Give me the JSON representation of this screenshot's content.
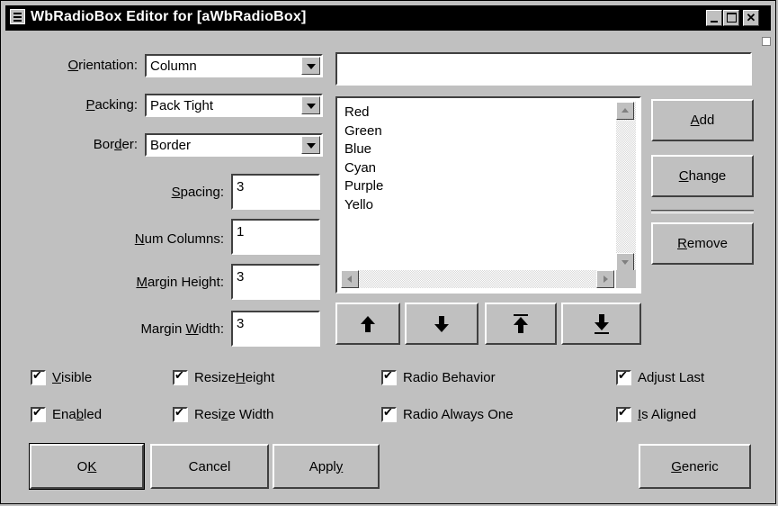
{
  "window": {
    "title": "WbRadioBox Editor for [aWbRadioBox]"
  },
  "orientation": {
    "label_pre": "",
    "label_u": "O",
    "label_post": "rientation:",
    "value": "Column"
  },
  "packing": {
    "label_pre": "",
    "label_u": "P",
    "label_post": "acking:",
    "value": "Pack Tight"
  },
  "border": {
    "label_pre": "Bor",
    "label_u": "d",
    "label_post": "er:",
    "value": "Border"
  },
  "spacing": {
    "label_pre": "",
    "label_u": "S",
    "label_post": "pacing:",
    "value": "3"
  },
  "num_columns": {
    "label_pre": "",
    "label_u": "N",
    "label_post": "um Columns:",
    "value": "1"
  },
  "margin_height": {
    "label_pre": "",
    "label_u": "M",
    "label_post": "argin Height:",
    "value": "3"
  },
  "margin_width": {
    "label_pre": "Margin ",
    "label_u": "W",
    "label_post": "idth:",
    "value": "3"
  },
  "item_input": {
    "value": ""
  },
  "list": {
    "items": [
      "Red",
      "Green",
      "Blue",
      "Cyan",
      "Purple",
      "Yello"
    ]
  },
  "buttons": {
    "add": {
      "pre": "",
      "u": "A",
      "post": "dd"
    },
    "change": {
      "pre": "",
      "u": "C",
      "post": "hange"
    },
    "remove": {
      "pre": "",
      "u": "R",
      "post": "emove"
    },
    "ok": {
      "pre": "O",
      "u": "K",
      "post": ""
    },
    "cancel": {
      "pre": "Cancel",
      "u": "",
      "post": ""
    },
    "apply": {
      "pre": "Appl",
      "u": "y",
      "post": ""
    },
    "generic": {
      "pre": "",
      "u": "G",
      "post": "eneric"
    }
  },
  "checkboxes": {
    "visible": {
      "pre": "",
      "u": "V",
      "post": "isible",
      "checked": true
    },
    "enabled": {
      "pre": "Ena",
      "u": "b",
      "post": "led",
      "checked": true
    },
    "resize_height": {
      "pre": "Resize ",
      "u": "H",
      "post": "eight",
      "checked": true
    },
    "resize_width": {
      "pre": "Resi",
      "u": "z",
      "post": "e Width",
      "checked": true
    },
    "radio_behavior": {
      "pre": "Radio Behavior",
      "u": "",
      "post": "",
      "checked": true
    },
    "radio_always_one": {
      "pre": "Radio Always One",
      "u": "",
      "post": "",
      "checked": true
    },
    "adjust_last": {
      "pre": "Adjust Last",
      "u": "",
      "post": "",
      "checked": true
    },
    "is_aligned": {
      "pre": "",
      "u": "I",
      "post": "s Aligned",
      "checked": true
    }
  },
  "icons": {
    "move_up": "up-arrow-icon",
    "move_down": "down-arrow-icon",
    "move_top": "top-arrow-icon",
    "move_bottom": "bottom-arrow-icon"
  }
}
